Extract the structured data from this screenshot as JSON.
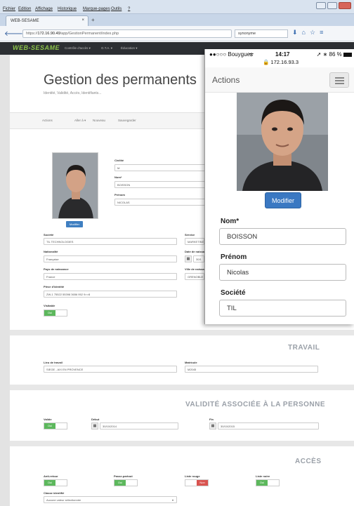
{
  "browser": {
    "menu": [
      "Fichier",
      "Edition",
      "Affichage",
      "Historique",
      "Marque-pages",
      "Outils",
      "?"
    ],
    "tab_title": "WEB-SESAME",
    "tab_close": "×",
    "new_tab": "+",
    "url_prefix": "https://",
    "url_host": "172.16.90.49",
    "url_path": "/app/GestionPermanent/index.php",
    "search_text": "synonyme"
  },
  "app": {
    "logo": "WEB-SESAME",
    "menu": [
      "Contrôle d'accès ▾",
      "G.T.A. ▾",
      "Éducation ▾"
    ],
    "page_title": "Gestion des permanents",
    "subtitle": "Identité, Validité, Accès, Identifiants...",
    "actions_label": "Actions",
    "actions": [
      "Aller à ▾",
      "Nouveau",
      "Sauvegarder"
    ],
    "photo_button": "Modifier",
    "fields": {
      "civilite_label": "Civilité",
      "civilite": "M.",
      "nom_label": "Nom*",
      "nom": "BOISSON",
      "prenom_label": "Prénom",
      "prenom": "NICOLAS",
      "societe_label": "Société",
      "societe": "TIL TECHNOLOGIES",
      "service_label": "Service",
      "service": "MARKETING",
      "nationalite_label": "Nationalité",
      "nationalite": "Française",
      "naissance_label": "Date de naissance",
      "naissance": "30/1",
      "pays_label": "Pays de naissance",
      "pays": "France",
      "ville_label": "Ville de naissance",
      "ville": "GRENOBLE",
      "piece_label": "Pièce d'identité",
      "piece": "ZW-1 75522 55398 3656 952 9>>8",
      "visitable_label": "Visitable",
      "visitable": "Oui"
    },
    "travail": {
      "title": "TRAVAIL",
      "lieu_label": "Lieu de travail",
      "lieu": "SIEGE - AIX EN PROVENCE",
      "matricule_label": "Matricule",
      "matricule": "M2045"
    },
    "validite": {
      "title": "VALIDITÉ ASSOCIÉE À LA PERSONNE",
      "valide_label": "Valide",
      "valide": "Oui",
      "debut_label": "Début",
      "debut": "30/10/2014",
      "fin_label": "Fin",
      "fin": "30/10/2015"
    },
    "acces": {
      "title": "ACCÈS",
      "antiretour_label": "Anti-retour",
      "antiretour": "Oui",
      "passepartout_label": "Passe-partout",
      "passepartout": "Oui",
      "listerouge_label": "Liste rouge",
      "listerouge": "Non",
      "listenoire_label": "Liste noire",
      "listenoire": "Oui",
      "classe_label": "Classe identifié",
      "classe": "Aucune valeur sélectionnée"
    }
  },
  "phone": {
    "carrier": "●●○○○ Bouygues",
    "time": "14:17",
    "ip": "🔒 172.16.93.3",
    "battery": "86 %",
    "title": "Actions",
    "button": "Modifier",
    "nom_label": "Nom*",
    "nom": "BOISSON",
    "prenom_label": "Prénom",
    "prenom": "Nicolas",
    "societe_label": "Société",
    "societe": "TIL"
  }
}
